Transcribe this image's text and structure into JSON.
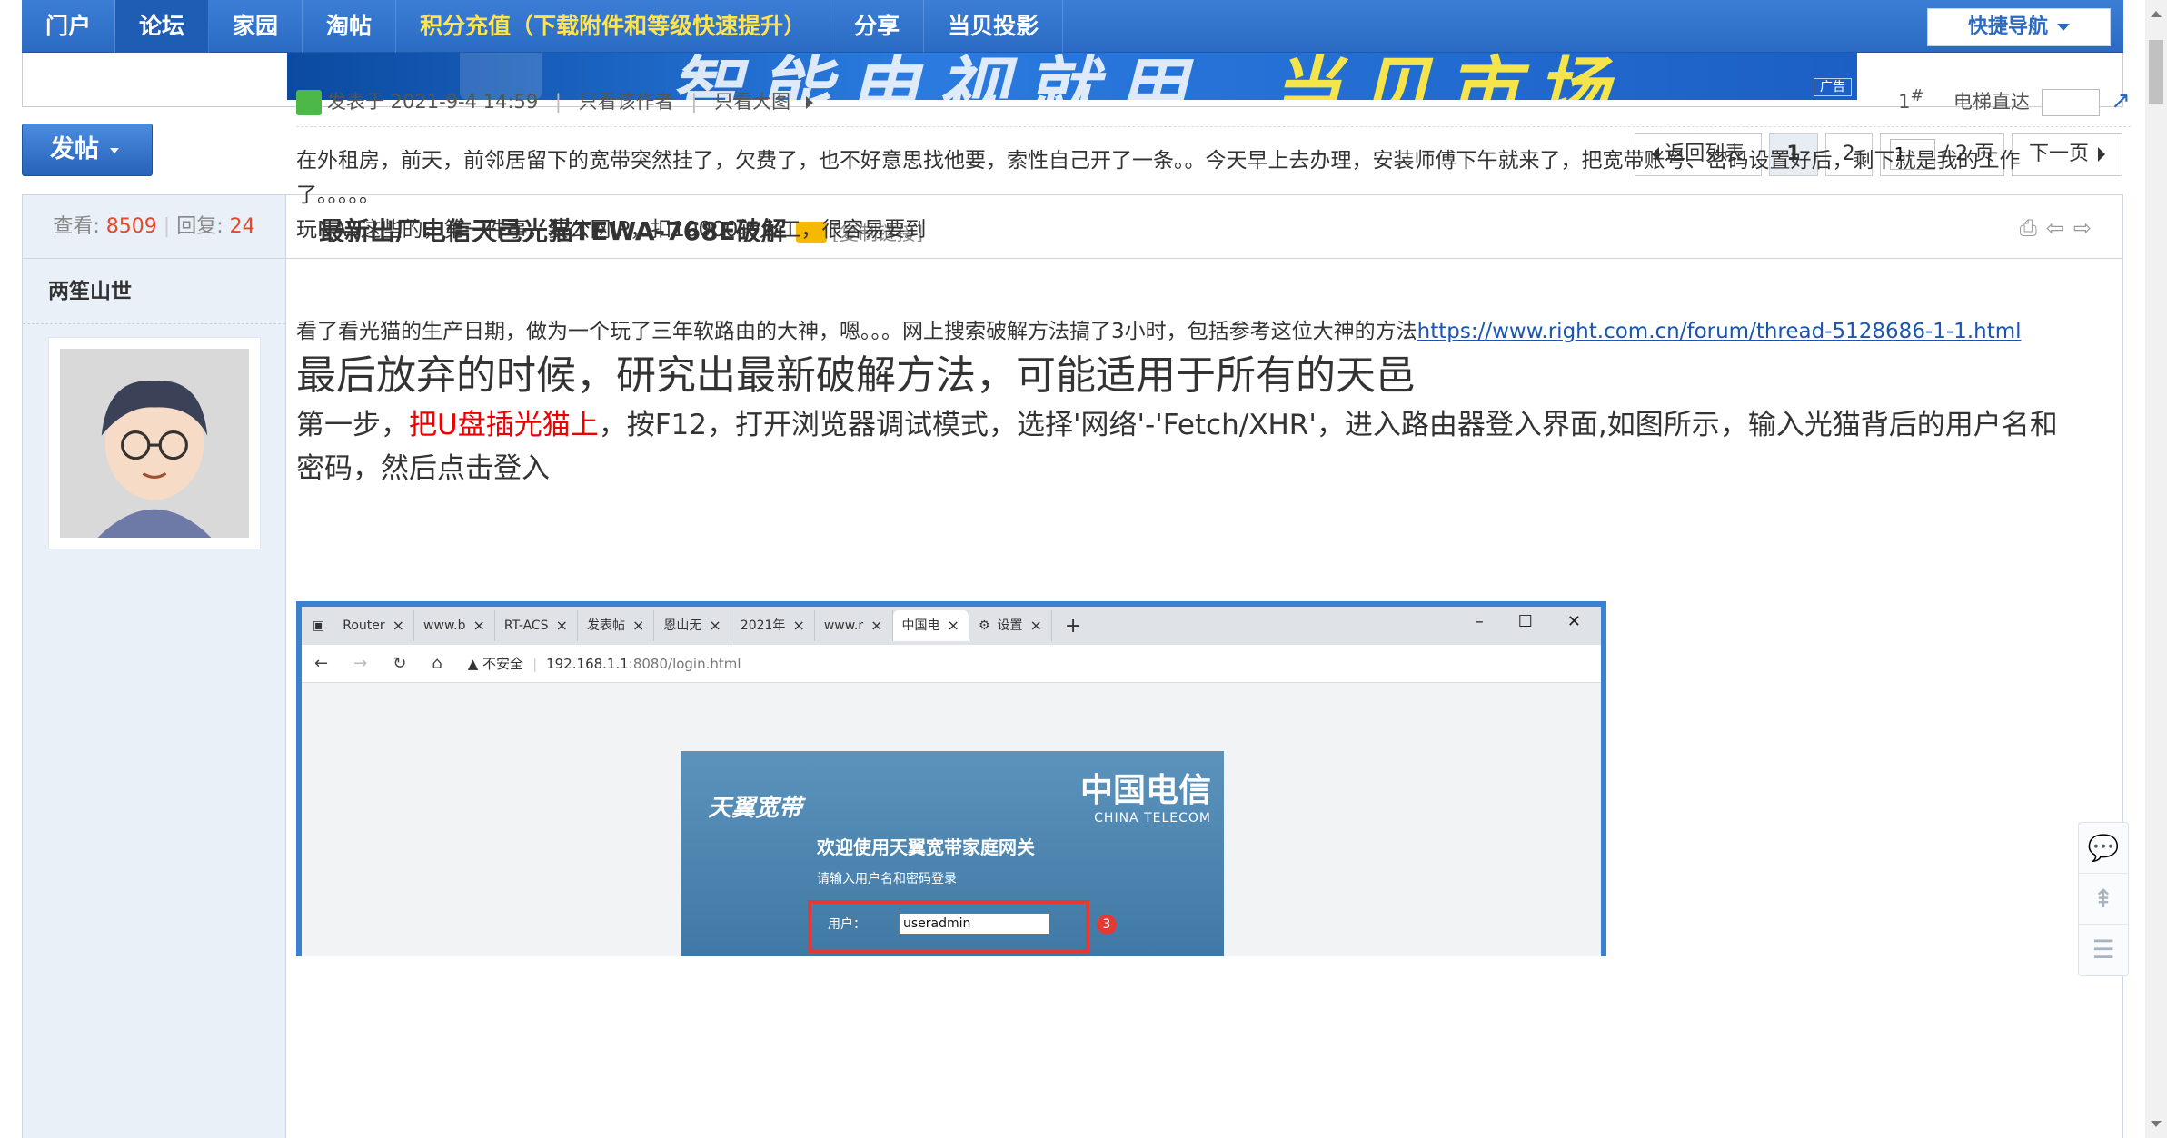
{
  "topnav": {
    "items": [
      {
        "label": "门户"
      },
      {
        "label": "论坛"
      },
      {
        "label": "家园"
      },
      {
        "label": "淘帖"
      },
      {
        "label": "积分充值（下载附件和等级快速提升）"
      },
      {
        "label": "分享"
      },
      {
        "label": "当贝投影"
      }
    ],
    "quicknav_label": "快捷导航"
  },
  "banner": {
    "text_left": "智能电视就用",
    "text_right": "当贝市场",
    "ad_tag": "广告"
  },
  "toolbar": {
    "post_button": "发帖",
    "pager": {
      "back_label": "返回列表",
      "pages": [
        "1",
        "2"
      ],
      "current_input": "1",
      "total_label": "/ 2 页",
      "next_label": "下一页"
    }
  },
  "thread": {
    "views_label": "查看:",
    "views": "8509",
    "replies_label": "回复:",
    "replies": "24",
    "title": "最新出厂电信天邑光猫TEWA-768E破解",
    "copy_link": "[复制链接]"
  },
  "post": {
    "author": "两笙山世",
    "posted_at": "发表于 2021-9-4 14:59",
    "only_author": "只看该作者",
    "only_images": "只看大图",
    "floor_number": "1",
    "floor_sup": "#",
    "elevator_label": "电梯直达",
    "paragraphs": {
      "p1": "在外租房，前天，前邻居留下的宽带突然挂了，欠费了，也不好意思找他要，索性自己开了一条。。今天早上去办理，安装师傅下午就来了，把宽带账号、密码设置好后，剩下就是我的工作了。。。。。",
      "p2": "玩NAS这些的，第一件事，要公网IP，扣10000转人工，很容易要到",
      "p3": "看了看光猫的生产日期，做为一个玩了三年软路由的大神，嗯。。。网上搜索破解方法搞了3小时，包括参考这位大神的方法",
      "p3_link": "https://www.right.com.cn/forum/thread-5128686-1-1.html",
      "p4": "最后放弃的时候，研究出最新破解方法，可能适用于所有的天邑",
      "p5_a": "第一步，",
      "p5_red": "把U盘插光猫上",
      "p5_b": "，按F12，打开浏览器调试模式，选择'网络'-'Fetch/XHR'，进入路由器登入界面,如图所示，输入光猫背后的用户名和密码，然后点击登入"
    }
  },
  "screenshot": {
    "tabs": [
      {
        "label": "Router"
      },
      {
        "label": "www.b"
      },
      {
        "label": "RT-ACS"
      },
      {
        "label": "发表帖"
      },
      {
        "label": "恩山无"
      },
      {
        "label": "2021年"
      },
      {
        "label": "www.r"
      },
      {
        "label": "中国电"
      },
      {
        "label": "设置"
      }
    ],
    "insecure_label": "不安全",
    "url_host": "192.168.1.1",
    "url_path": ":8080/login.html",
    "login": {
      "brand_left": "天翼宽带",
      "brand_right": "中国电信",
      "brand_right_en": "CHINA TELECOM",
      "welcome": "欢迎使用天翼宽带家庭网关",
      "hint": "请输入用户名和密码登录",
      "user_label": "用户：",
      "user_value": "useradmin",
      "step_badge": "3"
    }
  }
}
